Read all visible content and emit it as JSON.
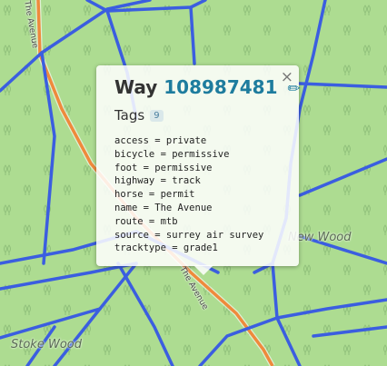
{
  "map": {
    "place_labels": [
      "New Wood",
      "Stoke Wood"
    ],
    "road_labels": [
      "The Avenue",
      "The Avenue"
    ],
    "colors": {
      "background": "#addc91",
      "path": "#3b5ee0",
      "road": "#ef8a3c",
      "road_casing": "#ffffff",
      "tree_symbol": "#8fbf7a"
    }
  },
  "popup": {
    "title_prefix": "Way",
    "way_id": "108987481",
    "edit_icon": "pencil-icon",
    "close_symbol": "×",
    "tags_heading": "Tags",
    "tags_count": "9",
    "tags": [
      "access = private",
      "bicycle = permissive",
      "foot = permissive",
      "highway = track",
      "horse = permit",
      "name = The Avenue",
      "route = mtb",
      "source = surrey air survey",
      "tracktype = grade1"
    ]
  }
}
